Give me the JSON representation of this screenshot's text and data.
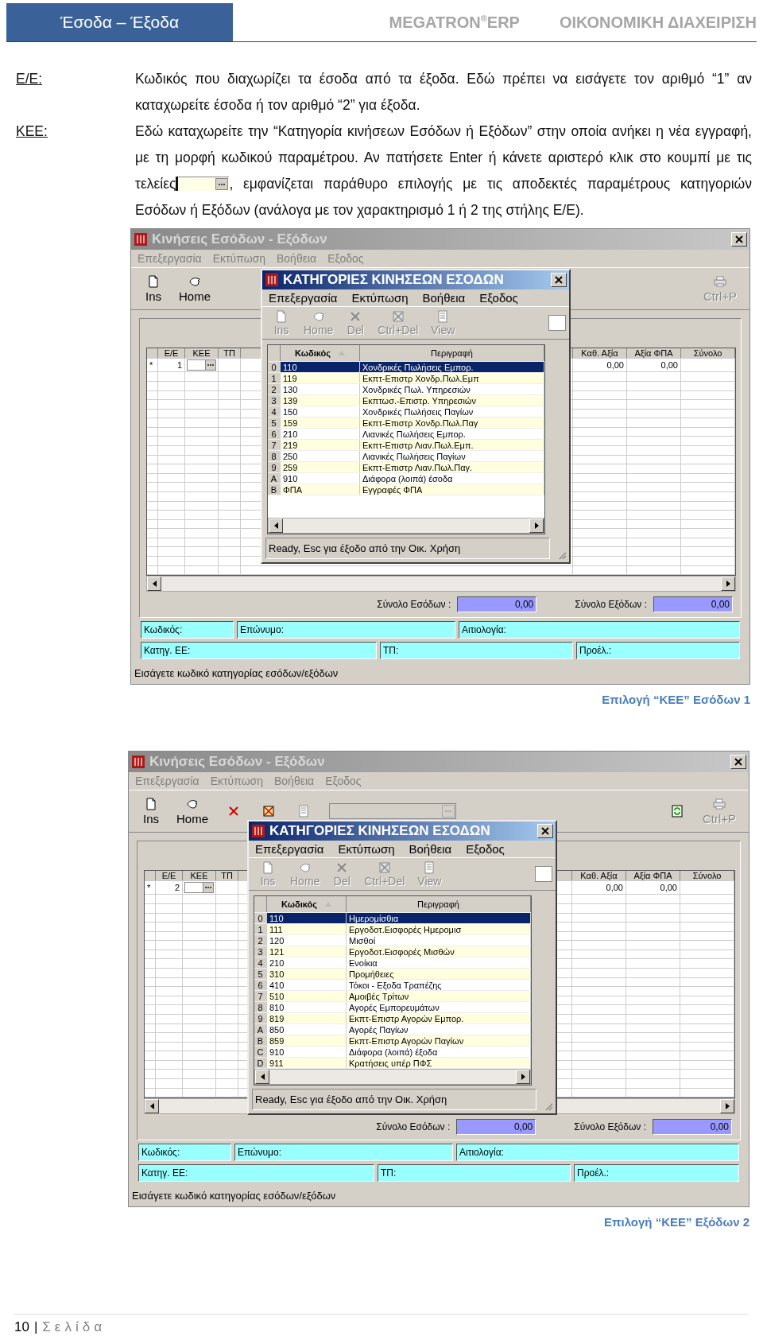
{
  "header": {
    "section_tab": "Έσοδα – Έξοδα",
    "product": "MEGATRON$^{®}$ERP",
    "module": "ΟΙΚΟΝΟΜΙΚΗ ΔΙΑΧΕΙΡΙΣΗ"
  },
  "definitions": [
    {
      "term": "Ε/Ε:",
      "text": "Κωδικός που διαχωρίζει τα έσοδα από τα έξοδα. Εδώ πρέπει να εισάγετε τον αριθμό “1” αν καταχωρείτε έσοδα ή τον αριθμό “2” για έξοδα."
    },
    {
      "term": "ΚΕΕ:",
      "text": "Εδώ καταχωρείτε την “Κατηγορία κινήσεων Εσόδων ή Εξόδων” στην οποία ανήκει η νέα εγγραφή, με τη μορφή κωδικού παραμέτρου. Αν πατήσετε Enter ή κάνετε αριστερό κλικ στο κουμπί με τις τελείες",
      "text_after": ", εμφανίζεται παράθυρο επιλογής με τις αποδεκτές παραμέτρους κατηγοριών Εσόδων ή Εξόδων (ανάλογα με τον χαρακτηρισμό 1 ή 2 της στήλης Ε/Ε)."
    }
  ],
  "figures": [
    {
      "window": {
        "title": "Κινήσεις Εσόδων - Εξόδων",
        "active": false,
        "menu": [
          "Επεξεργασία",
          "Εκτύπωση",
          "Βοήθεια",
          "Εξοδος"
        ],
        "toolbar": [
          {
            "kind": "new",
            "label": "Ins",
            "disabled": false
          },
          {
            "kind": "home",
            "label": "Home",
            "disabled": false
          }
        ],
        "toolbar_trailing": [
          {
            "kind": "print",
            "label": "Ctrl+P",
            "disabled": true
          }
        ],
        "grid": {
          "columns_left": [
            "Ε/Ε",
            "ΚΕΕ",
            "ΤΠ"
          ],
          "columns_right": [
            "Καθ. Αξία",
            "Αξία ΦΠΑ",
            "Σύνολο"
          ],
          "row": {
            "marker": "*",
            "ee": "1",
            "amounts": [
              "0,00",
              "0,00"
            ]
          }
        },
        "totals": [
          {
            "label": "Σύνολο Εσόδων :",
            "value": "0,00"
          },
          {
            "label": "Σύνολο Εξόδων :",
            "value": "0,00"
          }
        ],
        "info_rows": [
          [
            "Κωδικός:",
            "Επώνυμο:",
            "Αιτιολογία:"
          ],
          [
            "Κατηγ. ΕΕ:",
            "ΤΠ:",
            "Προέλ.:"
          ]
        ],
        "status": "Εισάγετε κωδικό κατηγορίας εσόδων/εξόδων"
      },
      "popup": {
        "title": "ΚΑΤΗΓΟΡΙΕΣ ΚΙΝΗΣΕΩΝ ΕΣΟΔΩΝ",
        "active": true,
        "menu": [
          "Επεξεργασία",
          "Εκτύπωση",
          "Βοήθεια",
          "Εξοδος"
        ],
        "toolbar": [
          {
            "kind": "new",
            "label": "Ins",
            "disabled": true
          },
          {
            "kind": "home",
            "label": "Home",
            "disabled": true
          },
          {
            "kind": "delete",
            "label": "Del",
            "disabled": true
          },
          {
            "kind": "delete_all",
            "label": "Ctrl+Del",
            "disabled": true
          },
          {
            "kind": "view",
            "label": "View",
            "disabled": true
          },
          {
            "kind": "field",
            "disabled": false
          }
        ],
        "columns": [
          "Κωδικός",
          "Περιγραφή"
        ],
        "rows": [
          {
            "index": "0",
            "code": "110",
            "description": "Χονδρικές Πωλήσεις Εμπορ.",
            "selected": true
          },
          {
            "index": "1",
            "code": "119",
            "description": "Εκπτ-Επιστρ Χονδρ.Πωλ.Εμπ",
            "selected": false
          },
          {
            "index": "2",
            "code": "130",
            "description": "Χονδρικές Πωλ. Υπηρεσιών",
            "selected": false
          },
          {
            "index": "3",
            "code": "139",
            "description": "Εκπτωσ.-Επιστρ. Υπηρεσιών",
            "selected": false
          },
          {
            "index": "4",
            "code": "150",
            "description": "Χονδρικές Πωλήσεις Παγίων",
            "selected": false
          },
          {
            "index": "5",
            "code": "159",
            "description": "Εκπτ-Επιστρ Χονδρ.Πωλ.Παγ",
            "selected": false
          },
          {
            "index": "6",
            "code": "210",
            "description": "Λιανικές Πωλήσεις Εμπορ.",
            "selected": false
          },
          {
            "index": "7",
            "code": "219",
            "description": "Εκπτ-Επιστρ Λιαν.Πωλ.Εμπ.",
            "selected": false
          },
          {
            "index": "8",
            "code": "250",
            "description": "Λιανικές Πωλήσεις Παγίων",
            "selected": false
          },
          {
            "index": "9",
            "code": "259",
            "description": "Εκπτ-Επιστρ Λιαν.Πωλ.Παγ.",
            "selected": false
          },
          {
            "index": "A",
            "code": "910",
            "description": "Διάφορα (λοιπά) έσοδα",
            "selected": false
          },
          {
            "index": "B",
            "code": "ΦΠΑ",
            "description": "Εγγραφές ΦΠΑ",
            "selected": false
          }
        ],
        "status": "Ready, Esc για έξοδο από την Οικ. Χρήση"
      },
      "caption": "Επιλογή “ΚΕΕ” Εσόδων 1"
    },
    {
      "window": {
        "title": "Κινήσεις Εσόδων - Εξόδων",
        "active": false,
        "menu": [
          "Επεξεργασία",
          "Εκτύπωση",
          "Βοήθεια",
          "Εξοδος"
        ],
        "toolbar": [
          {
            "kind": "new",
            "label": "Ins",
            "disabled": false
          },
          {
            "kind": "home",
            "label": "Home",
            "disabled": false
          },
          {
            "kind": "delete",
            "disabled": false
          },
          {
            "kind": "delete_all",
            "disabled": false
          },
          {
            "kind": "view",
            "disabled": true
          },
          {
            "kind": "field",
            "disabled": true
          }
        ],
        "toolbar_trailing": [
          {
            "kind": "refresh",
            "disabled": false
          },
          {
            "kind": "print",
            "label": "Ctrl+P",
            "disabled": true
          }
        ],
        "grid": {
          "columns_left": [
            "Ε/Ε",
            "ΚΕΕ",
            "ΤΠ"
          ],
          "columns_right": [
            "Καθ. Αξία",
            "Αξία ΦΠΑ",
            "Σύνολο"
          ],
          "row": {
            "marker": "*",
            "ee": "2",
            "amounts": [
              "0,00",
              "0,00"
            ]
          }
        },
        "totals": [
          {
            "label": "Σύνολο Εσόδων :",
            "value": "0,00"
          },
          {
            "label": "Σύνολο Εξόδων :",
            "value": "0,00"
          }
        ],
        "info_rows": [
          [
            "Κωδικός:",
            "Επώνυμο:",
            "Αιτιολογία:"
          ],
          [
            "Κατηγ. ΕΕ:",
            "ΤΠ:",
            "Προέλ.:"
          ]
        ],
        "status": "Εισάγετε κωδικό κατηγορίας εσόδων/εξόδων"
      },
      "popup": {
        "title": "ΚΑΤΗΓΟΡΙΕΣ ΚΙΝΗΣΕΩΝ ΕΣΟΔΩΝ",
        "active": true,
        "menu": [
          "Επεξεργασία",
          "Εκτύπωση",
          "Βοήθεια",
          "Εξοδος"
        ],
        "toolbar": [
          {
            "kind": "new",
            "label": "Ins",
            "disabled": true
          },
          {
            "kind": "home",
            "label": "Home",
            "disabled": true
          },
          {
            "kind": "delete",
            "label": "Del",
            "disabled": true
          },
          {
            "kind": "delete_all",
            "label": "Ctrl+Del",
            "disabled": true
          },
          {
            "kind": "view",
            "label": "View",
            "disabled": true
          },
          {
            "kind": "field",
            "disabled": false
          }
        ],
        "columns": [
          "Κωδικός",
          "Περιγραφή"
        ],
        "rows": [
          {
            "index": "0",
            "code": "110",
            "description": "Ημερομίσθια",
            "selected": true
          },
          {
            "index": "1",
            "code": "111",
            "description": "Εργοδοτ.Εισφορές Ημερομισ",
            "selected": false
          },
          {
            "index": "2",
            "code": "120",
            "description": "Μισθοί",
            "selected": false
          },
          {
            "index": "3",
            "code": "121",
            "description": "Εργοδοτ.Εισφορές Μισθών",
            "selected": false
          },
          {
            "index": "4",
            "code": "210",
            "description": "Ενοίκια",
            "selected": false
          },
          {
            "index": "5",
            "code": "310",
            "description": "Προμήθειες",
            "selected": false
          },
          {
            "index": "6",
            "code": "410",
            "description": "Τόκοι - Εξοδα Τραπέζης",
            "selected": false
          },
          {
            "index": "7",
            "code": "510",
            "description": "Αμοιβές Τρίτων",
            "selected": false
          },
          {
            "index": "8",
            "code": "810",
            "description": "Αγορές Εμπορευμάτων",
            "selected": false
          },
          {
            "index": "9",
            "code": "819",
            "description": "Εκπτ-Επιστρ Αγορών Εμπορ.",
            "selected": false
          },
          {
            "index": "A",
            "code": "850",
            "description": "Αγορές Παγίων",
            "selected": false
          },
          {
            "index": "B",
            "code": "859",
            "description": "Εκπτ-Επιστρ Αγορών Παγίων",
            "selected": false
          },
          {
            "index": "C",
            "code": "910",
            "description": "Διάφορα (λοιπά) έξοδα",
            "selected": false
          },
          {
            "index": "D",
            "code": "911",
            "description": "Κρατήσεις υπέρ ΠΦΣ",
            "selected": false
          }
        ],
        "status": "Ready, Esc για έξοδο από την Οικ. Χρήση"
      },
      "caption": "Επιλογή “ΚΕΕ” Εξόδων 2"
    }
  ],
  "footer": {
    "page_number": "10",
    "separator": "|",
    "page_word": "Σελίδα"
  }
}
